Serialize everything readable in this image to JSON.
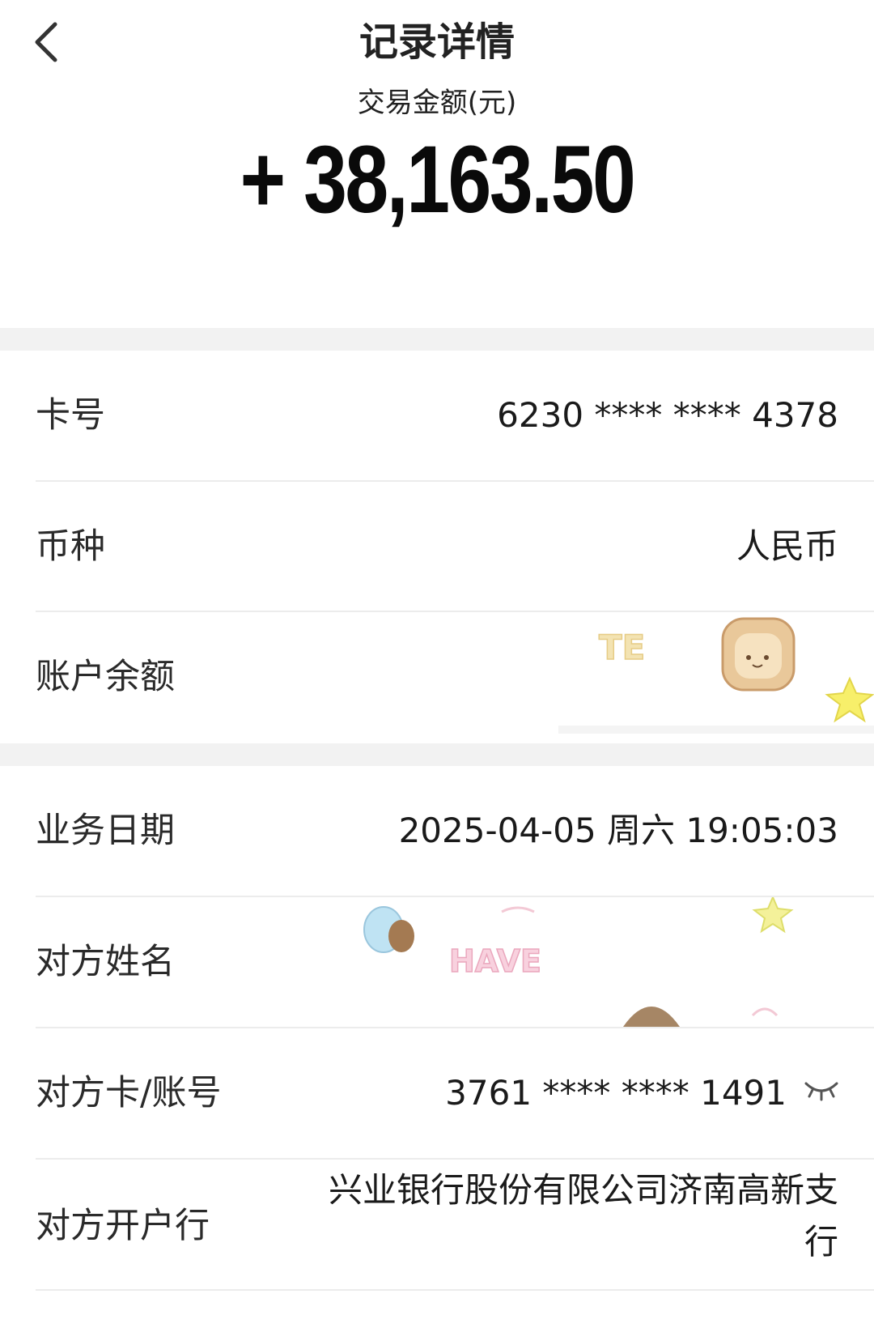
{
  "header": {
    "title": "记录详情",
    "amount_label": "交易金额(元)",
    "amount_value": "+ 38,163.50"
  },
  "details": {
    "card_number": {
      "label": "卡号",
      "value": "6230 **** **** 4378"
    },
    "currency": {
      "label": "币种",
      "value": "人民币"
    },
    "balance": {
      "label": "账户余额",
      "value": ""
    },
    "business_date": {
      "label": "业务日期",
      "value": "2025-04-05 周六 19:05:03"
    },
    "counterparty_name": {
      "label": "对方姓名",
      "value": ""
    },
    "counterparty_account": {
      "label": "对方卡/账号",
      "value": "3761 **** **** 1491"
    },
    "counterparty_bank": {
      "label": "对方开户行",
      "value_line1": "兴业银行股份有限公司济南高新支",
      "value_line2": "行"
    }
  },
  "stickers": {
    "balance_text": "TE",
    "name_text": "HAVE"
  },
  "icons": {
    "back": "chevron-left-icon",
    "eye": "eye-closed-icon"
  },
  "colors": {
    "background": "#ffffff",
    "section_gap": "#f2f2f2",
    "divider": "#ececec",
    "text": "#1e1e1e"
  }
}
